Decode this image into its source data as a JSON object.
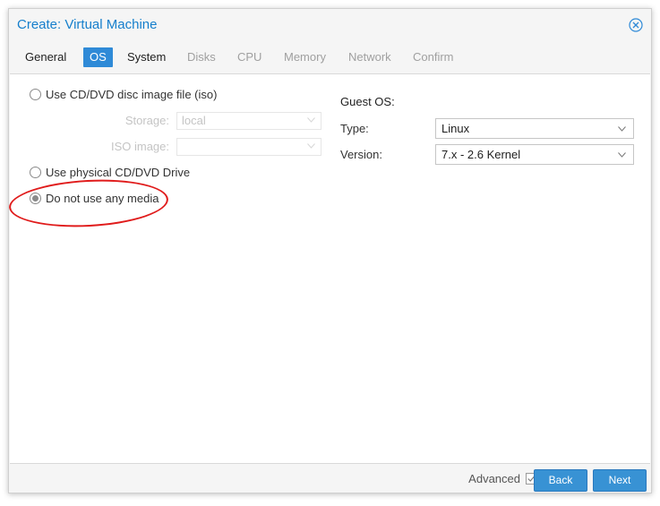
{
  "dialog": {
    "title": "Create: Virtual Machine"
  },
  "tabs": [
    {
      "label": "General",
      "state": "enabled"
    },
    {
      "label": "OS",
      "state": "active"
    },
    {
      "label": "System",
      "state": "enabled"
    },
    {
      "label": "Disks",
      "state": "disabled"
    },
    {
      "label": "CPU",
      "state": "disabled"
    },
    {
      "label": "Memory",
      "state": "disabled"
    },
    {
      "label": "Network",
      "state": "disabled"
    },
    {
      "label": "Confirm",
      "state": "disabled"
    }
  ],
  "media": {
    "option_iso": "Use CD/DVD disc image file (iso)",
    "storage_label": "Storage:",
    "storage_value": "local",
    "iso_label": "ISO image:",
    "iso_value": "",
    "option_physical": "Use physical CD/DVD Drive",
    "option_none": "Do not use any media",
    "selected": "none"
  },
  "guest_os": {
    "title": "Guest OS:",
    "type_label": "Type:",
    "type_value": "Linux",
    "version_label": "Version:",
    "version_value": "7.x - 2.6 Kernel"
  },
  "footer": {
    "advanced_label": "Advanced",
    "advanced_checked": true,
    "back_label": "Back",
    "next_label": "Next"
  },
  "colors": {
    "accent": "#157fcc",
    "button": "#3892d4",
    "highlight": "#e01b1b"
  }
}
